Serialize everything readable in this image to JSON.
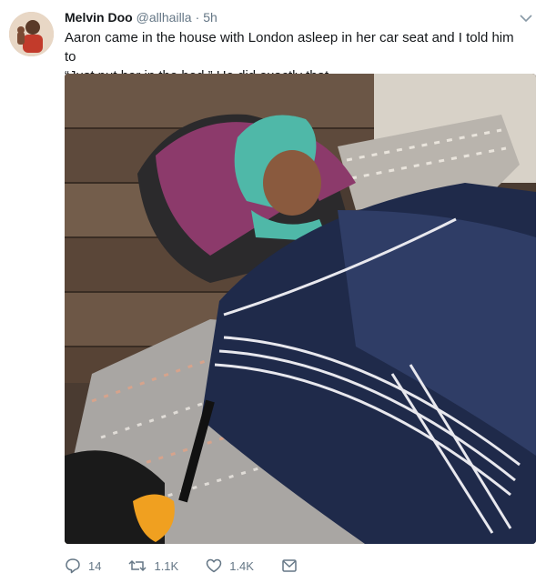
{
  "tweet": {
    "author": {
      "display_name": "Melvin Doo",
      "handle": "@allhailla",
      "separator": "·",
      "time": "5h"
    },
    "text": "Aaron came in the house with London asleep in her car seat and I told him to\n“Just put her in the bed.” He did exactly that.",
    "actions": {
      "reply_count": "14",
      "retweet_count": "1.1K",
      "like_count": "1.4K"
    }
  },
  "icons": {
    "caret": "chevron-down-icon",
    "reply": "reply-icon",
    "retweet": "retweet-icon",
    "like": "heart-icon",
    "message": "envelope-icon"
  },
  "colors": {
    "text_primary": "#14171a",
    "text_secondary": "#657786"
  }
}
